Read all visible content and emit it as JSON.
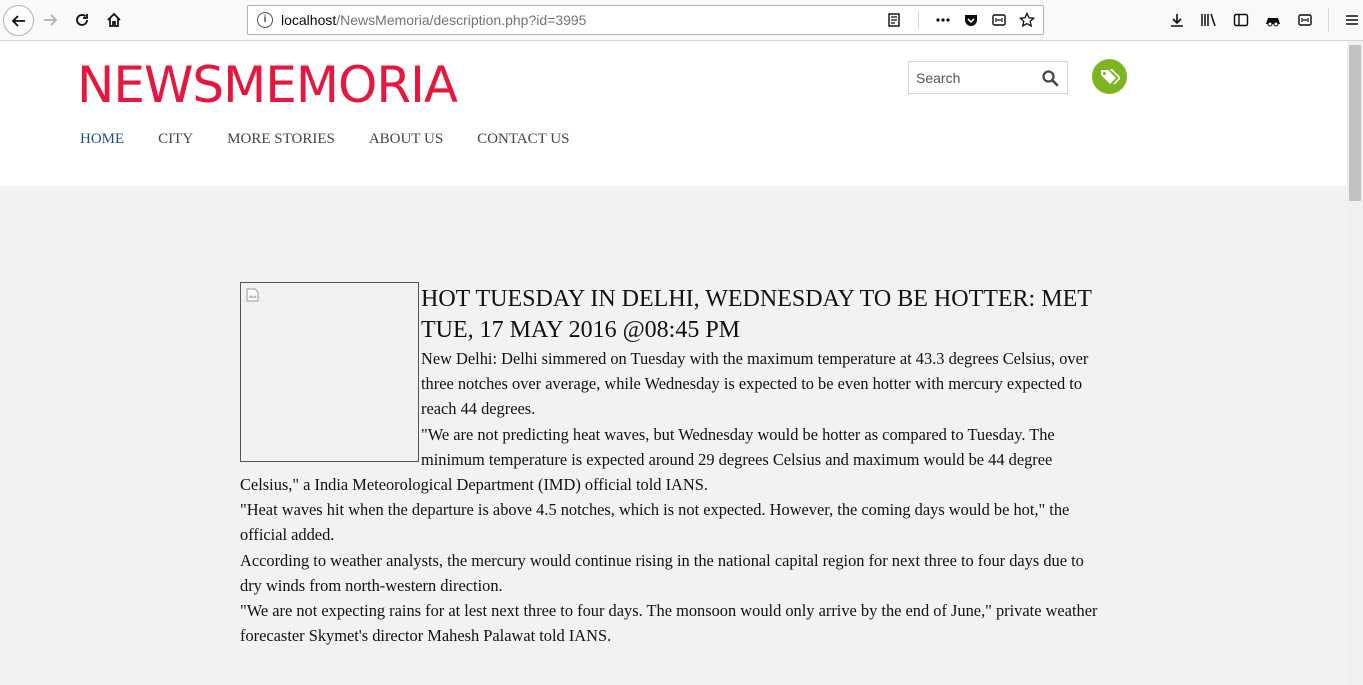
{
  "browser": {
    "url_host": "localhost",
    "url_path": "/NewsMemoria/description.php?id=3995"
  },
  "site": {
    "logo": "NEWSMEMORIA",
    "search_placeholder": "Search",
    "nav": [
      "HOME",
      "CITY",
      "MORE STORIES",
      "ABOUT US",
      "CONTACT US"
    ],
    "accent_color": "#e8163d",
    "tag_color": "#7cb51d"
  },
  "article": {
    "title": "HOT TUESDAY IN DELHI, WEDNESDAY TO BE HOTTER: MET",
    "date": "TUE, 17 MAY 2016 @08:45 PM",
    "paragraphs": [
      "New Delhi: Delhi simmered on Tuesday with the maximum temperature at 43.3 degrees Celsius, over three notches over average, while Wednesday is expected to be even hotter with mercury expected to reach 44 degrees.",
      "\"We are not predicting heat waves, but Wednesday would be hotter as compared to Tuesday. The minimum temperature is expected around 29 degrees Celsius and maximum would be 44 degree Celsius,\" a India Meteorological Department (IMD) official told IANS.",
      "\"Heat waves hit when the departure is above 4.5 notches, which is not expected. However, the coming days would be hot,\" the official added.",
      "According to weather analysts, the mercury would continue rising in the national capital region for next three to four days due to dry winds from north-western direction.",
      "\"We are not expecting rains for at lest next three to four days. The monsoon would only arrive by the end of June,\" private weather forecaster Skymet's director Mahesh Palawat told IANS."
    ]
  }
}
